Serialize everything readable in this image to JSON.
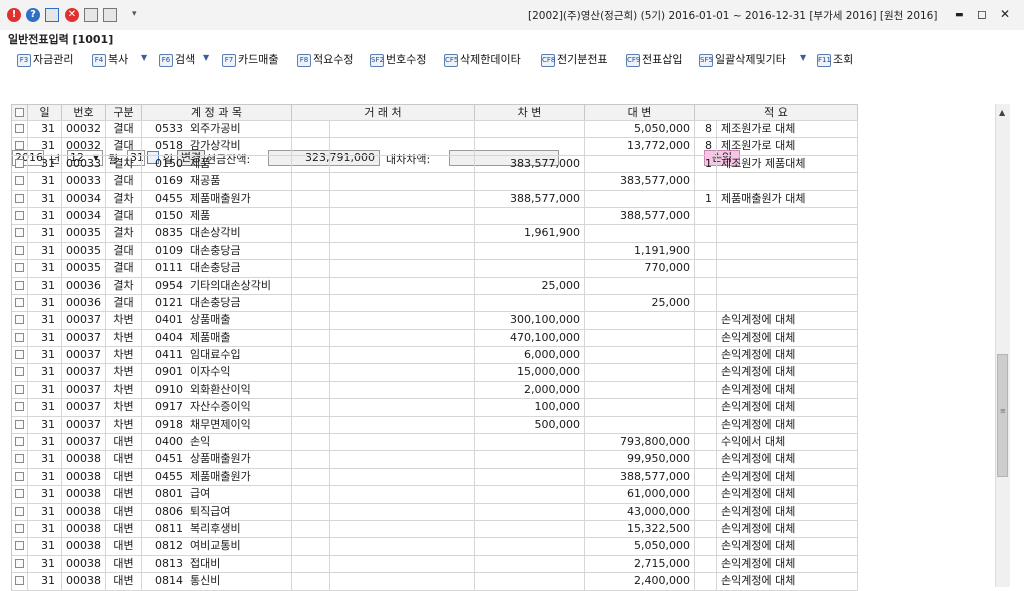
{
  "title": "[2002](주)영산(정근희) (5기) 2016-01-01 ~ 2016-12-31 [부가세 2016] [원천 2016]",
  "window_controls": {
    "minimize": "▬",
    "restore": "◻",
    "close": "✕"
  },
  "screen_name": "일반전표입력 [1001]",
  "toolbar": [
    {
      "key": "F3",
      "label": "자금관리"
    },
    {
      "key": "F4",
      "label": "복사"
    },
    {
      "key": "F6",
      "label": "검색"
    },
    {
      "key": "F7",
      "label": "카드매출"
    },
    {
      "key": "F8",
      "label": "적요수정"
    },
    {
      "key": "SF2",
      "label": "번호수정"
    },
    {
      "key": "CF5",
      "label": "삭제한데이타"
    },
    {
      "key": "CF8",
      "label": "전기분전표"
    },
    {
      "key": "CF9",
      "label": "전표삽입"
    },
    {
      "key": "SF5",
      "label": "일괄삭제및기타"
    },
    {
      "key": "F11",
      "label": "조회"
    }
  ],
  "filter": {
    "year": "2016",
    "year_label": "년",
    "month": "12",
    "month_label": "월",
    "day": "31",
    "day_label": "일",
    "change_button": "변경",
    "cash_label": "현금잔액:",
    "cash_value": "323,791,000",
    "diff_label": "대차차액:",
    "diff_value": "",
    "pl_badge": "손익"
  },
  "table": {
    "headers": [
      "",
      "일",
      "번호",
      "구분",
      "계 정 과 목",
      "거 래 처",
      "차 변",
      "대 변",
      "적 요"
    ],
    "rows": [
      {
        "day": "31",
        "no": "00032",
        "type": "결대",
        "code": "0533",
        "account": "외주가공비",
        "partner": "",
        "debit": "",
        "credit": "5,050,000",
        "memo_code": "8",
        "memo": "제조원가로 대체"
      },
      {
        "day": "31",
        "no": "00032",
        "type": "결대",
        "code": "0518",
        "account": "감가상각비",
        "partner": "",
        "debit": "",
        "credit": "13,772,000",
        "memo_code": "8",
        "memo": "제조원가로 대체"
      },
      {
        "day": "31",
        "no": "00033",
        "type": "결차",
        "code": "0150",
        "account": "제품",
        "partner": "",
        "debit": "383,577,000",
        "credit": "",
        "memo_code": "1",
        "memo": "제조원가 제품대체"
      },
      {
        "day": "31",
        "no": "00033",
        "type": "결대",
        "code": "0169",
        "account": "재공품",
        "partner": "",
        "debit": "",
        "credit": "383,577,000",
        "memo_code": "",
        "memo": ""
      },
      {
        "day": "31",
        "no": "00034",
        "type": "결차",
        "code": "0455",
        "account": "제품매출원가",
        "partner": "",
        "debit": "388,577,000",
        "credit": "",
        "memo_code": "1",
        "memo": "제품매출원가 대체"
      },
      {
        "day": "31",
        "no": "00034",
        "type": "결대",
        "code": "0150",
        "account": "제품",
        "partner": "",
        "debit": "",
        "credit": "388,577,000",
        "memo_code": "",
        "memo": ""
      },
      {
        "day": "31",
        "no": "00035",
        "type": "결차",
        "code": "0835",
        "account": "대손상각비",
        "partner": "",
        "debit": "1,961,900",
        "credit": "",
        "memo_code": "",
        "memo": ""
      },
      {
        "day": "31",
        "no": "00035",
        "type": "결대",
        "code": "0109",
        "account": "대손충당금",
        "partner": "",
        "debit": "",
        "credit": "1,191,900",
        "memo_code": "",
        "memo": ""
      },
      {
        "day": "31",
        "no": "00035",
        "type": "결대",
        "code": "0111",
        "account": "대손충당금",
        "partner": "",
        "debit": "",
        "credit": "770,000",
        "memo_code": "",
        "memo": ""
      },
      {
        "day": "31",
        "no": "00036",
        "type": "결차",
        "code": "0954",
        "account": "기타의대손상각비",
        "partner": "",
        "debit": "25,000",
        "credit": "",
        "memo_code": "",
        "memo": ""
      },
      {
        "day": "31",
        "no": "00036",
        "type": "결대",
        "code": "0121",
        "account": "대손충당금",
        "partner": "",
        "debit": "",
        "credit": "25,000",
        "memo_code": "",
        "memo": ""
      },
      {
        "day": "31",
        "no": "00037",
        "type": "차변",
        "code": "0401",
        "account": "상품매출",
        "partner": "",
        "debit": "300,100,000",
        "credit": "",
        "memo_code": "",
        "memo": "손익계정에 대체"
      },
      {
        "day": "31",
        "no": "00037",
        "type": "차변",
        "code": "0404",
        "account": "제품매출",
        "partner": "",
        "debit": "470,100,000",
        "credit": "",
        "memo_code": "",
        "memo": "손익계정에 대체"
      },
      {
        "day": "31",
        "no": "00037",
        "type": "차변",
        "code": "0411",
        "account": "임대료수입",
        "partner": "",
        "debit": "6,000,000",
        "credit": "",
        "memo_code": "",
        "memo": "손익계정에 대체"
      },
      {
        "day": "31",
        "no": "00037",
        "type": "차변",
        "code": "0901",
        "account": "이자수익",
        "partner": "",
        "debit": "15,000,000",
        "credit": "",
        "memo_code": "",
        "memo": "손익계정에 대체"
      },
      {
        "day": "31",
        "no": "00037",
        "type": "차변",
        "code": "0910",
        "account": "외화환산이익",
        "partner": "",
        "debit": "2,000,000",
        "credit": "",
        "memo_code": "",
        "memo": "손익계정에 대체"
      },
      {
        "day": "31",
        "no": "00037",
        "type": "차변",
        "code": "0917",
        "account": "자산수증이익",
        "partner": "",
        "debit": "100,000",
        "credit": "",
        "memo_code": "",
        "memo": "손익계정에 대체"
      },
      {
        "day": "31",
        "no": "00037",
        "type": "차변",
        "code": "0918",
        "account": "채무면제이익",
        "partner": "",
        "debit": "500,000",
        "credit": "",
        "memo_code": "",
        "memo": "손익계정에 대체"
      },
      {
        "day": "31",
        "no": "00037",
        "type": "대변",
        "code": "0400",
        "account": "손익",
        "partner": "",
        "debit": "",
        "credit": "793,800,000",
        "memo_code": "",
        "memo": "수익에서 대체"
      },
      {
        "day": "31",
        "no": "00038",
        "type": "대변",
        "code": "0451",
        "account": "상품매출원가",
        "partner": "",
        "debit": "",
        "credit": "99,950,000",
        "memo_code": "",
        "memo": "손익계정에 대체"
      },
      {
        "day": "31",
        "no": "00038",
        "type": "대변",
        "code": "0455",
        "account": "제품매출원가",
        "partner": "",
        "debit": "",
        "credit": "388,577,000",
        "memo_code": "",
        "memo": "손익계정에 대체"
      },
      {
        "day": "31",
        "no": "00038",
        "type": "대변",
        "code": "0801",
        "account": "급여",
        "partner": "",
        "debit": "",
        "credit": "61,000,000",
        "memo_code": "",
        "memo": "손익계정에 대체"
      },
      {
        "day": "31",
        "no": "00038",
        "type": "대변",
        "code": "0806",
        "account": "퇴직급여",
        "partner": "",
        "debit": "",
        "credit": "43,000,000",
        "memo_code": "",
        "memo": "손익계정에 대체"
      },
      {
        "day": "31",
        "no": "00038",
        "type": "대변",
        "code": "0811",
        "account": "복리후생비",
        "partner": "",
        "debit": "",
        "credit": "15,322,500",
        "memo_code": "",
        "memo": "손익계정에 대체"
      },
      {
        "day": "31",
        "no": "00038",
        "type": "대변",
        "code": "0812",
        "account": "여비교통비",
        "partner": "",
        "debit": "",
        "credit": "5,050,000",
        "memo_code": "",
        "memo": "손익계정에 대체"
      },
      {
        "day": "31",
        "no": "00038",
        "type": "대변",
        "code": "0813",
        "account": "접대비",
        "partner": "",
        "debit": "",
        "credit": "2,715,000",
        "memo_code": "",
        "memo": "손익계정에 대체"
      },
      {
        "day": "31",
        "no": "00038",
        "type": "대변",
        "code": "0814",
        "account": "통신비",
        "partner": "",
        "debit": "",
        "credit": "2,400,000",
        "memo_code": "",
        "memo": "손익계정에 대체"
      }
    ]
  },
  "colors": {
    "pl_badge_bg": "#f6c6e6",
    "title_red": "#e03030",
    "title_blue": "#2f6fc6"
  }
}
